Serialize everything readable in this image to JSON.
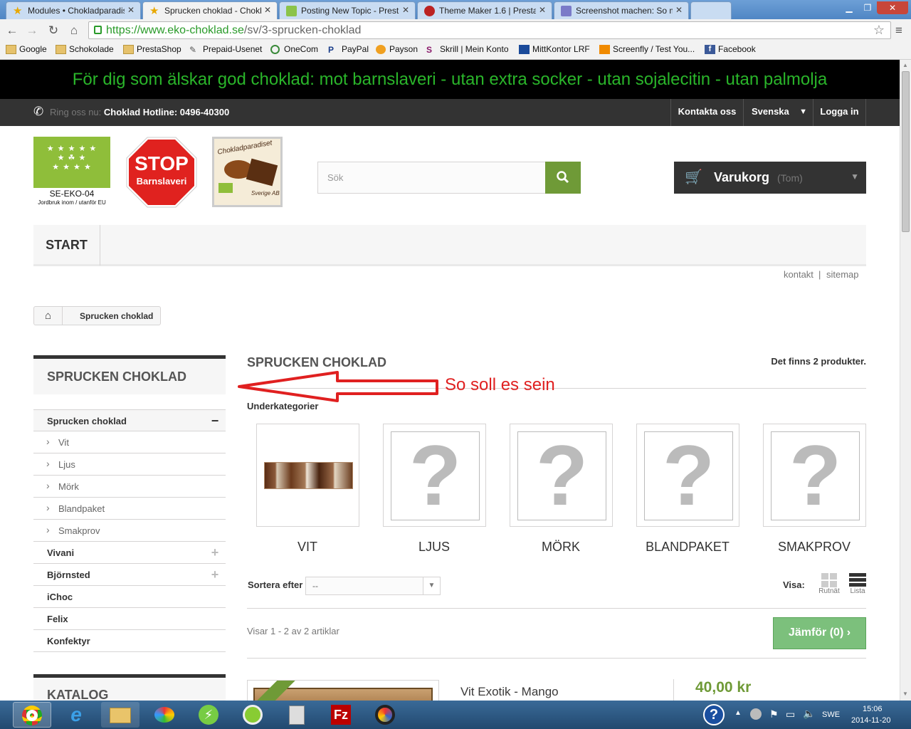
{
  "browser": {
    "tabs": [
      {
        "label": "Modules • Chokladparadis",
        "active": false
      },
      {
        "label": "Sprucken choklad - Chokl",
        "active": true
      },
      {
        "label": "Posting New Topic - Prest",
        "active": false
      },
      {
        "label": "Theme Maker 1.6 | Prestas",
        "active": false
      },
      {
        "label": "Screenshot machen: So m",
        "active": false
      }
    ],
    "url_host": "https://www.eko-choklad.se",
    "url_path": "/sv/3-sprucken-choklad",
    "bookmarks": [
      "Google",
      "Schokolade",
      "PrestaShop",
      "Prepaid-Usenet",
      "OneCom",
      "PayPal",
      "Payson",
      "Skrill | Mein Konto",
      "MittKontor LRF",
      "Screenfly / Test You...",
      "Facebook"
    ]
  },
  "promo": "För dig som älskar god choklad: mot barnslaveri - utan extra socker - utan sojalecitin - utan palmolja",
  "hotline": {
    "label": "Ring oss nu:",
    "value": "Choklad Hotline: 0496-40300"
  },
  "topnav": {
    "contact": "Kontakta oss",
    "language": "Svenska",
    "login": "Logga in"
  },
  "logos": {
    "eko_code": "SE-EKO-04",
    "eko_sub": "Jordbruk inom / utanför EU",
    "stop_1": "STOP",
    "stop_2": "Barnslaveri",
    "brand": "Chokladparadiset",
    "brand_sub": "Sverige AB"
  },
  "search": {
    "placeholder": "Sök"
  },
  "cart": {
    "label": "Varukorg",
    "status": "(Tom)"
  },
  "menu": {
    "start": "START"
  },
  "links": {
    "kontakt": "kontakt",
    "sep": "|",
    "sitemap": "sitemap"
  },
  "breadcrumb": {
    "current": "Sprucken choklad"
  },
  "sidebar": {
    "title": "SPRUCKEN CHOKLAD",
    "items": [
      {
        "label": "Sprucken choklad",
        "toggle": "−"
      },
      {
        "label": "Vit"
      },
      {
        "label": "Ljus"
      },
      {
        "label": "Mörk"
      },
      {
        "label": "Blandpaket"
      },
      {
        "label": "Smakprov"
      },
      {
        "label": "Vivani",
        "toggle": "+"
      },
      {
        "label": "Björnsted",
        "toggle": "+"
      },
      {
        "label": "iChoc"
      },
      {
        "label": "Felix"
      },
      {
        "label": "Konfektyr"
      }
    ],
    "katalog": "KATALOG"
  },
  "main": {
    "title": "SPRUCKEN CHOKLAD",
    "count": "Det finns 2 produkter.",
    "annotation": "So soll es sein",
    "subcat_label": "Underkategorier",
    "subcats": [
      "Vit",
      "Ljus",
      "Mörk",
      "Blandpaket",
      "Smakprov"
    ],
    "placeholder_glyph": "?",
    "sort_label": "Sortera efter",
    "sort_value": "--",
    "view_label": "Visa:",
    "grid_label": "Rutnät",
    "list_label": "Lista",
    "showing": "Visar 1 - 2 av 2 artiklar",
    "compare": "Jämför (0)",
    "product_name": "Vit Exotik - Mango",
    "product_price": "40,00 kr"
  },
  "taskbar": {
    "lang": "SWE",
    "time": "15:06",
    "date": "2014-11-20"
  },
  "colors": {
    "green": "#6f9a37",
    "promo_text": "#2ab52a",
    "annotation": "#e02020"
  }
}
